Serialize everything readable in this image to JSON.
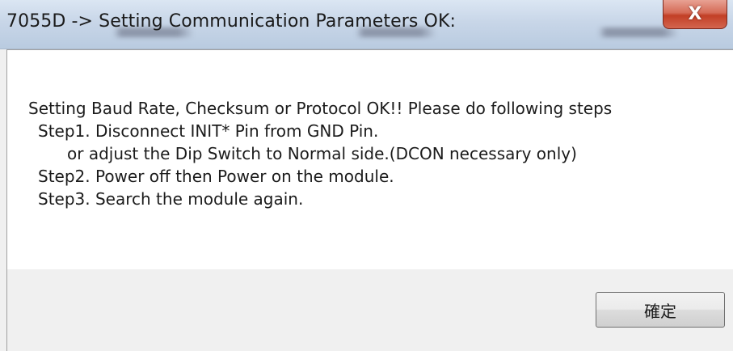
{
  "window": {
    "title": "7055D -> Setting Communication Parameters OK:",
    "close_label": "X"
  },
  "message": {
    "lines": [
      "Setting Baud Rate, Checksum or Protocol OK!! Please do following steps",
      "Step1. Disconnect INIT* Pin from GND Pin.",
      "or adjust the Dip Switch to Normal side.(DCON necessary only)",
      "Step2. Power off then Power on the module.",
      "Step3. Search the module again."
    ]
  },
  "buttons": {
    "ok_label": "確定"
  }
}
